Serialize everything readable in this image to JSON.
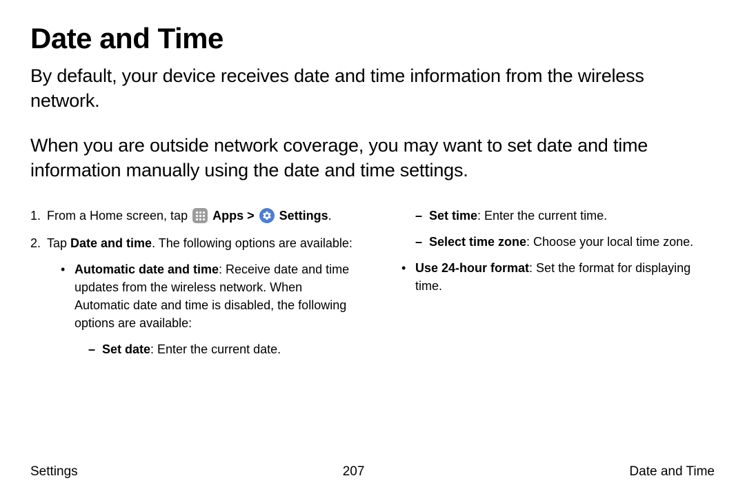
{
  "title": "Date and Time",
  "intro_p1": "By default, your device receives date and time information from the wireless network.",
  "intro_p2": "When you are outside network coverage, you may want to set date and time information manually using the date and time settings.",
  "steps": {
    "s1_num": "1.",
    "s1_pre": "From a Home screen, tap ",
    "s1_apps": "Apps",
    "s1_sep": " > ",
    "s1_settings": "Settings",
    "s1_post": ".",
    "s2_num": "2.",
    "s2_pre": "Tap ",
    "s2_bold": "Date and time",
    "s2_post": ". The following options are available:"
  },
  "options": {
    "auto_label": "Automatic date and time",
    "auto_desc": ": Receive date and time updates from the wireless network. When Automatic date and time is disabled, the following options are available:",
    "set_date_label": "Set date",
    "set_date_desc": ": Enter the current date.",
    "set_time_label": "Set time",
    "set_time_desc": ": Enter the current time.",
    "tz_label": "Select time zone",
    "tz_desc": ": Choose your local time zone.",
    "h24_label": "Use 24-hour format",
    "h24_desc": ": Set the format for displaying time."
  },
  "footer": {
    "left": "Settings",
    "center": "207",
    "right": "Date and Time"
  }
}
